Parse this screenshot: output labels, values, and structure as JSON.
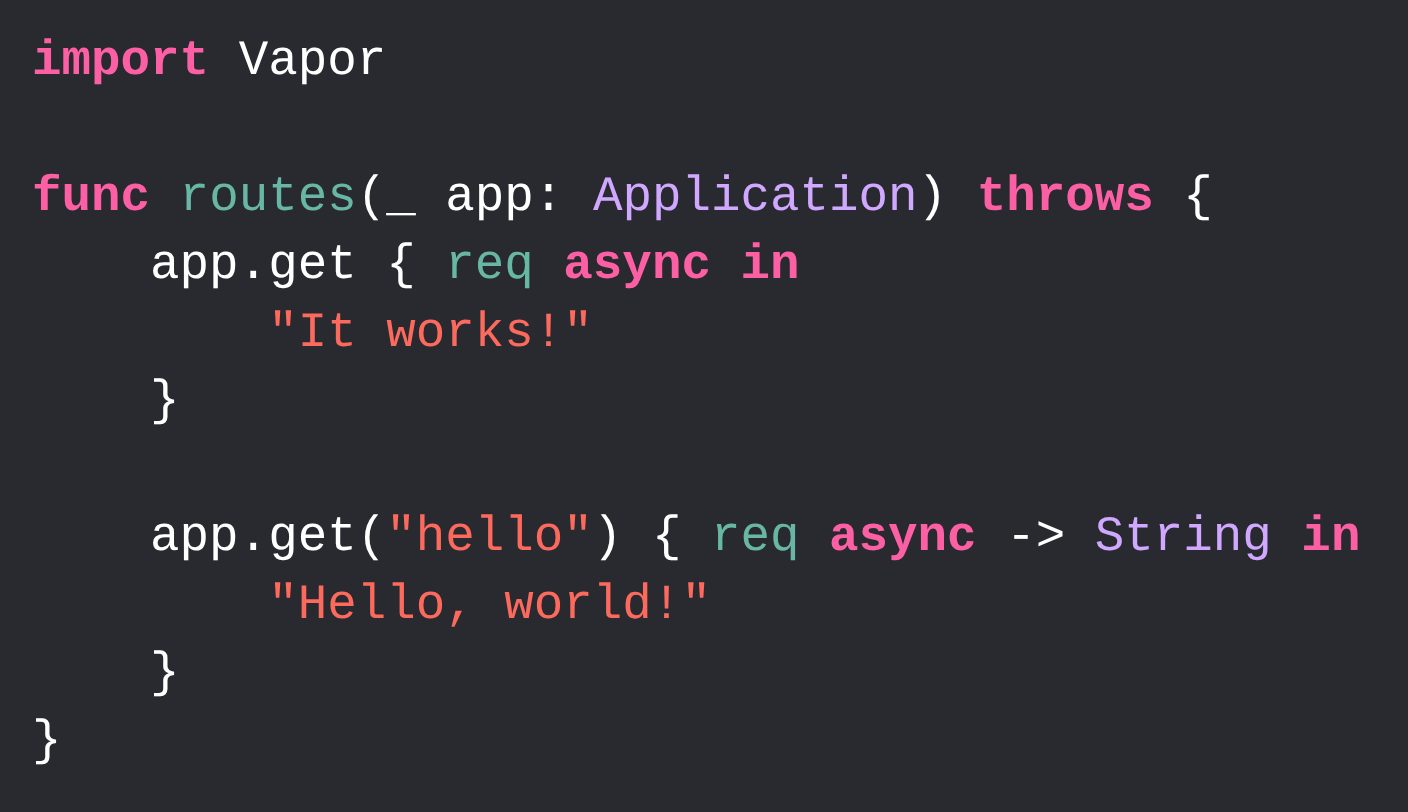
{
  "editor": {
    "lines": [
      {
        "kind": "code",
        "tokens": [
          {
            "text": "import",
            "kind": "keyword"
          },
          {
            "text": " Vapor",
            "kind": "plain"
          }
        ]
      },
      {
        "kind": "blank"
      },
      {
        "kind": "code",
        "tokens": [
          {
            "text": "func",
            "kind": "keyword"
          },
          {
            "text": " routes",
            "kind": "function"
          },
          {
            "text": "(_ app: ",
            "kind": "plain"
          },
          {
            "text": "Application",
            "kind": "type"
          },
          {
            "text": ") ",
            "kind": "plain"
          },
          {
            "text": "throws",
            "kind": "keyword"
          },
          {
            "text": " {",
            "kind": "plain"
          }
        ]
      },
      {
        "kind": "code",
        "tokens": [
          {
            "text": "    app.get { ",
            "kind": "plain"
          },
          {
            "text": "req",
            "kind": "function"
          },
          {
            "text": " async",
            "kind": "keyword"
          },
          {
            "text": " in",
            "kind": "keyword"
          }
        ]
      },
      {
        "kind": "code",
        "tokens": [
          {
            "text": "        \"It works!\"",
            "kind": "string"
          }
        ]
      },
      {
        "kind": "code",
        "tokens": [
          {
            "text": "    }",
            "kind": "plain"
          }
        ]
      },
      {
        "kind": "blank"
      },
      {
        "kind": "code",
        "tokens": [
          {
            "text": "    app.get(",
            "kind": "plain"
          },
          {
            "text": "\"hello\"",
            "kind": "string"
          },
          {
            "text": ") { ",
            "kind": "plain"
          },
          {
            "text": "req",
            "kind": "function"
          },
          {
            "text": " async",
            "kind": "keyword"
          },
          {
            "text": " -> ",
            "kind": "plain"
          },
          {
            "text": "String",
            "kind": "type"
          },
          {
            "text": " in",
            "kind": "keyword"
          }
        ]
      },
      {
        "kind": "code",
        "tokens": [
          {
            "text": "        \"Hello, world!\"",
            "kind": "string"
          }
        ]
      },
      {
        "kind": "code",
        "tokens": [
          {
            "text": "    }",
            "kind": "plain"
          }
        ]
      },
      {
        "kind": "code",
        "tokens": [
          {
            "text": "}",
            "kind": "plain"
          }
        ]
      }
    ]
  }
}
